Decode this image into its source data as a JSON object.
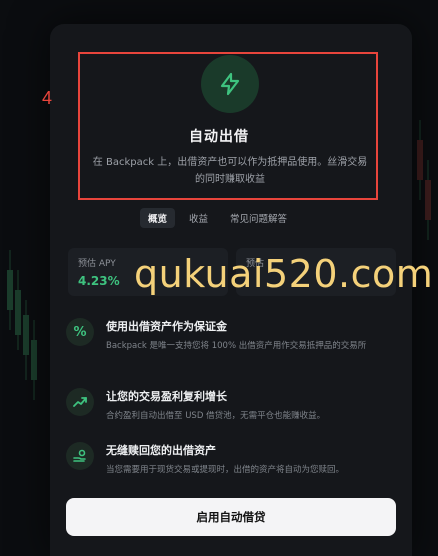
{
  "annotation": {
    "number": "4"
  },
  "header": {
    "icon": "lightning-bolt-icon",
    "title": "自动出借",
    "description": "在 Backpack 上，出借资产也可以作为抵押品使用。丝滑交易的同时赚取收益"
  },
  "tabs": [
    {
      "label": "概览",
      "active": true
    },
    {
      "label": "收益",
      "active": false
    },
    {
      "label": "常见问题解答",
      "active": false
    }
  ],
  "stats": [
    {
      "label": "预估 APY",
      "value": "4.23%"
    },
    {
      "label": "预估",
      "value": ""
    }
  ],
  "watermark": "qukuai520.com",
  "features": [
    {
      "icon": "percent-icon",
      "title": "使用出借资产作为保证金",
      "desc": "Backpack 是唯一支持您将 100% 出借资产用作交易抵押品的交易所"
    },
    {
      "icon": "trending-up-icon",
      "title": "让您的交易盈利复利增长",
      "desc": "合约盈利自动出借至 USD 借贷池，无需平仓也能赚收益。"
    },
    {
      "icon": "hand-coin-icon",
      "title": "无缝赎回您的出借资产",
      "desc": "当您需要用于现货交易或提现时，出借的资产将自动为您赎回。"
    }
  ],
  "cta": {
    "label": "启用自动借贷"
  },
  "colors": {
    "accent": "#3ec27f",
    "highlight": "#e8453c",
    "watermark": "#f4d17a"
  }
}
